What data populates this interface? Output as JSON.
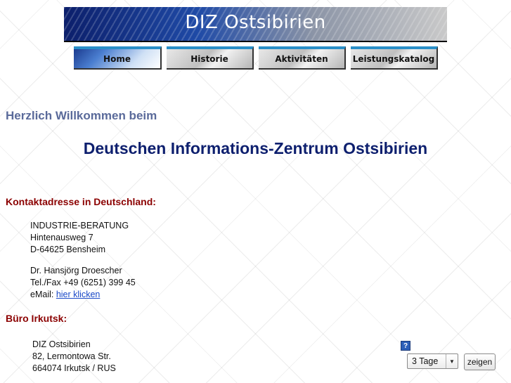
{
  "banner": {
    "title": "DIZ Ostsibirien"
  },
  "nav": [
    {
      "label": "Home"
    },
    {
      "label": "Historie"
    },
    {
      "label": "Aktivitäten"
    },
    {
      "label": "Leistungskatalog"
    }
  ],
  "intro": {
    "line1": "Herzlich Willkommen beim",
    "line2": "Deutschen Informations-Zentrum Ostsibirien"
  },
  "germany": {
    "title": "Kontaktadresse in Deutschland:",
    "company": "INDUSTRIE-BERATUNG",
    "street": "Hintenausweg 7",
    "city": "D-64625 Bensheim",
    "person": "Dr. Hansjörg Droescher",
    "phone": "Tel./Fax +49 (6251) 399 45",
    "email_prefix": "eMail: ",
    "email_link": "hier klicken"
  },
  "irkutsk": {
    "title": "Büro Irkutsk:",
    "name": "DIZ Ostsibirien",
    "street": "82, Lermontowa Str.",
    "city": "664074 Irkutsk / RUS"
  },
  "widget": {
    "help_icon": "?",
    "select_value": "3 Tage",
    "button": "zeigen"
  },
  "colors": {
    "heading_blue": "#0d1f6e",
    "section_red": "#8b0000",
    "link_blue": "#1a49c8"
  }
}
